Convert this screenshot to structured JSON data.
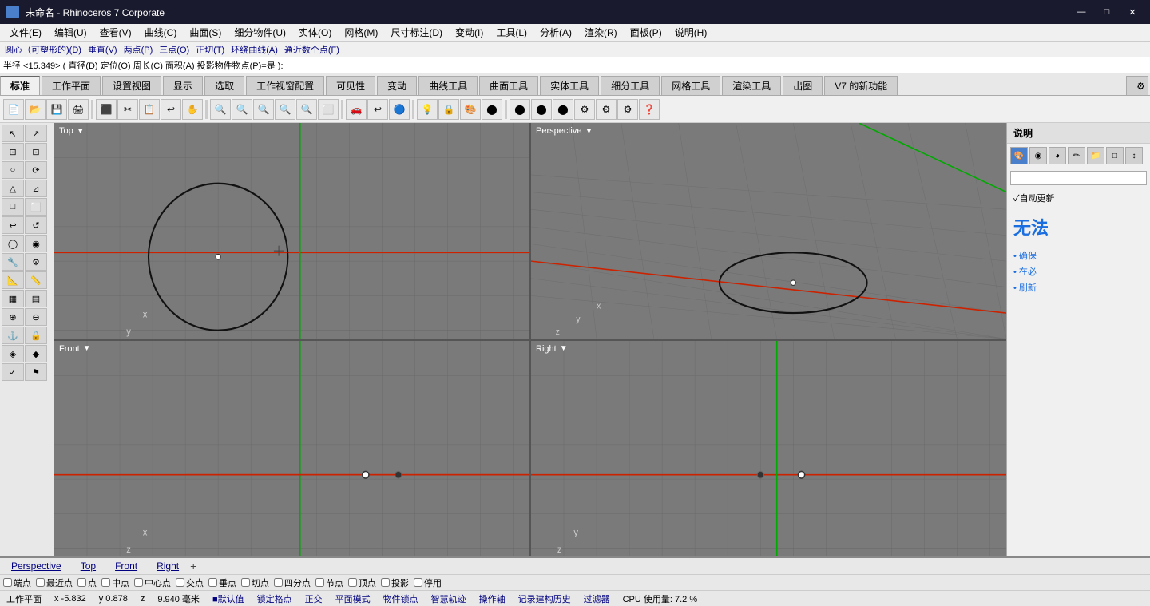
{
  "titleBar": {
    "title": "未命名 - Rhinoceros 7 Corporate",
    "minimizeLabel": "—",
    "maximizeLabel": "□",
    "closeLabel": "✕"
  },
  "menuBar": {
    "items": [
      "文件(E)",
      "编辑(U)",
      "查看(V)",
      "曲线(C)",
      "曲面(S)",
      "细分物件(U)",
      "实体(O)",
      "网格(M)",
      "尺寸标注(D)",
      "变动(I)",
      "工具(L)",
      "分析(A)",
      "渲染(R)",
      "面板(P)",
      "说明(H)"
    ]
  },
  "cmdBar": {
    "items": [
      "圆心（可塑形的)(D)",
      "垂直(V)",
      "两点(P)",
      "三点(O)",
      "正切(T)",
      "环绕曲线(A)",
      "通近数个点(F)"
    ]
  },
  "cmdInput": {
    "text": "半径 <15.349> ( 直径(D) 定位(O) 周长(C) 面积(A) 投影物件物点(P)=是 ):"
  },
  "topTabs": {
    "items": [
      "标准",
      "工作平面",
      "设置视图",
      "显示",
      "选取",
      "工作视窗配置",
      "可见性",
      "变动",
      "曲线工具",
      "曲面工具",
      "实体工具",
      "细分工具",
      "网格工具",
      "渲染工具",
      "出图",
      "V7 的新功能"
    ],
    "activeIndex": 0,
    "settingsIcon": "⚙"
  },
  "viewports": {
    "topLeft": {
      "label": "Top",
      "hasDropdown": true,
      "axisX": "x",
      "axisY": "y"
    },
    "topRight": {
      "label": "Perspective",
      "hasDropdown": true,
      "axisX": "x",
      "axisY": "y",
      "axisZ": "z"
    },
    "bottomLeft": {
      "label": "Front",
      "hasDropdown": true,
      "axisX": "x",
      "axisZ": "z"
    },
    "bottomRight": {
      "label": "Right",
      "hasDropdown": true,
      "axisY": "y",
      "axisZ": "z"
    }
  },
  "rightPanel": {
    "title": "说明",
    "autoUpdateLabel": "✓自动更新",
    "errorText": "无法",
    "hints": [
      "• 确保",
      "• 在必",
      "• 刷新"
    ]
  },
  "bottomTabs": {
    "items": [
      "Perspective",
      "Top",
      "Front",
      "Right"
    ],
    "addIcon": "+"
  },
  "snapBar": {
    "items": [
      "端点",
      "最近点",
      "点",
      "中点",
      "中心点",
      "交点",
      "垂点",
      "切点",
      "四分点",
      "节点",
      "顶点",
      "投影",
      "停用"
    ]
  },
  "statusBar": {
    "workplane": "工作平面",
    "x": "x  -5.832",
    "y": "y  0.878",
    "z": "z",
    "units": "9.940  毫米",
    "defaultLayer": "■默认值",
    "items": [
      "锁定格点",
      "正交",
      "平面模式",
      "物件锁点",
      "智慧轨迹",
      "操作轴",
      "记录建构历史",
      "过滤器"
    ],
    "cpu": "CPU 使用量: 7.2 %"
  },
  "colors": {
    "gridLine": "#888888",
    "redLine": "#cc2200",
    "greenLine": "#00aa00",
    "circleStroke": "#111111",
    "circleCenter": "#ffffff",
    "gridBg": "#7a7a7a",
    "viewportBorder": "#555"
  }
}
